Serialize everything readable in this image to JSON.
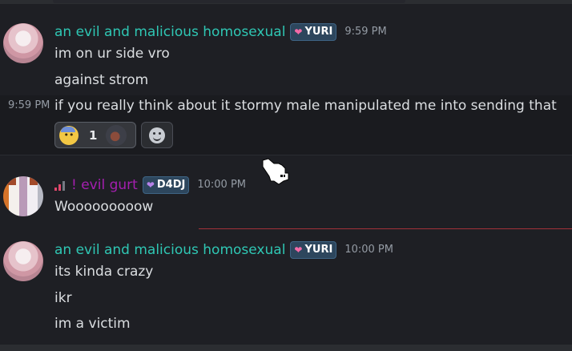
{
  "messages": [
    {
      "author": "an evil and malicious homosexual",
      "badge": "YURI",
      "badge_icon": "pink-heart-icon",
      "time": "9:59 PM",
      "lines": [
        "im on ur side vro",
        "against strom"
      ]
    },
    {
      "side_time": "9:59 PM",
      "text": "if you really think about it stormy male manipulated me into sending that",
      "reaction": {
        "emoji": "anxious-face-with-sweat-icon",
        "count": "1"
      }
    },
    {
      "author": "! evil gurt",
      "badge": "D4DJ",
      "badge_icon": "purple-heart-icon",
      "time": "10:00 PM",
      "lines": [
        "Wooooooooow"
      ]
    },
    {
      "author": "an evil and malicious homosexual",
      "badge": "YURI",
      "badge_icon": "pink-heart-icon",
      "time": "10:00 PM",
      "lines": [
        "its kinda crazy",
        "ikr",
        "im a victim"
      ]
    }
  ],
  "colors": {
    "background": "#1e1f24",
    "teal_name": "#2fc7b4",
    "purple_name": "#a51fb0",
    "new_messages_line": "#a3323a"
  }
}
